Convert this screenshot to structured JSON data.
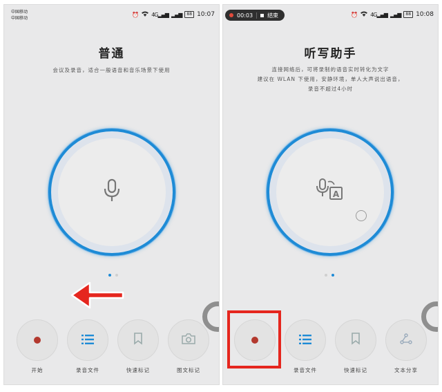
{
  "left": {
    "status": {
      "carrier_line1": "中国移动",
      "carrier_line2": "中国移动",
      "signal": "4G",
      "battery": "88",
      "time": "10:07"
    },
    "title": "普通",
    "description": "会议及录音，适合一般语音和音乐场景下使用",
    "controls": [
      "开始",
      "录音文件",
      "快速标记",
      "图文标记"
    ]
  },
  "right": {
    "status": {
      "rec_time": "00:03",
      "rec_end": "结束",
      "signal": "4G",
      "battery": "88",
      "time": "10:08"
    },
    "title": "听写助手",
    "description": [
      "连接网络后，可将录制的语音实时转化为文字",
      "建议在 WLAN 下使用，安静环境，单人大声说出语音，",
      "录音不超过4小时"
    ],
    "controls": [
      "",
      "录音文件",
      "快速标记",
      "文本分享"
    ]
  },
  "colors": {
    "accent_blue": "#1e8bd6",
    "record_red": "#b3392e",
    "annotation_red": "#e5261e"
  }
}
